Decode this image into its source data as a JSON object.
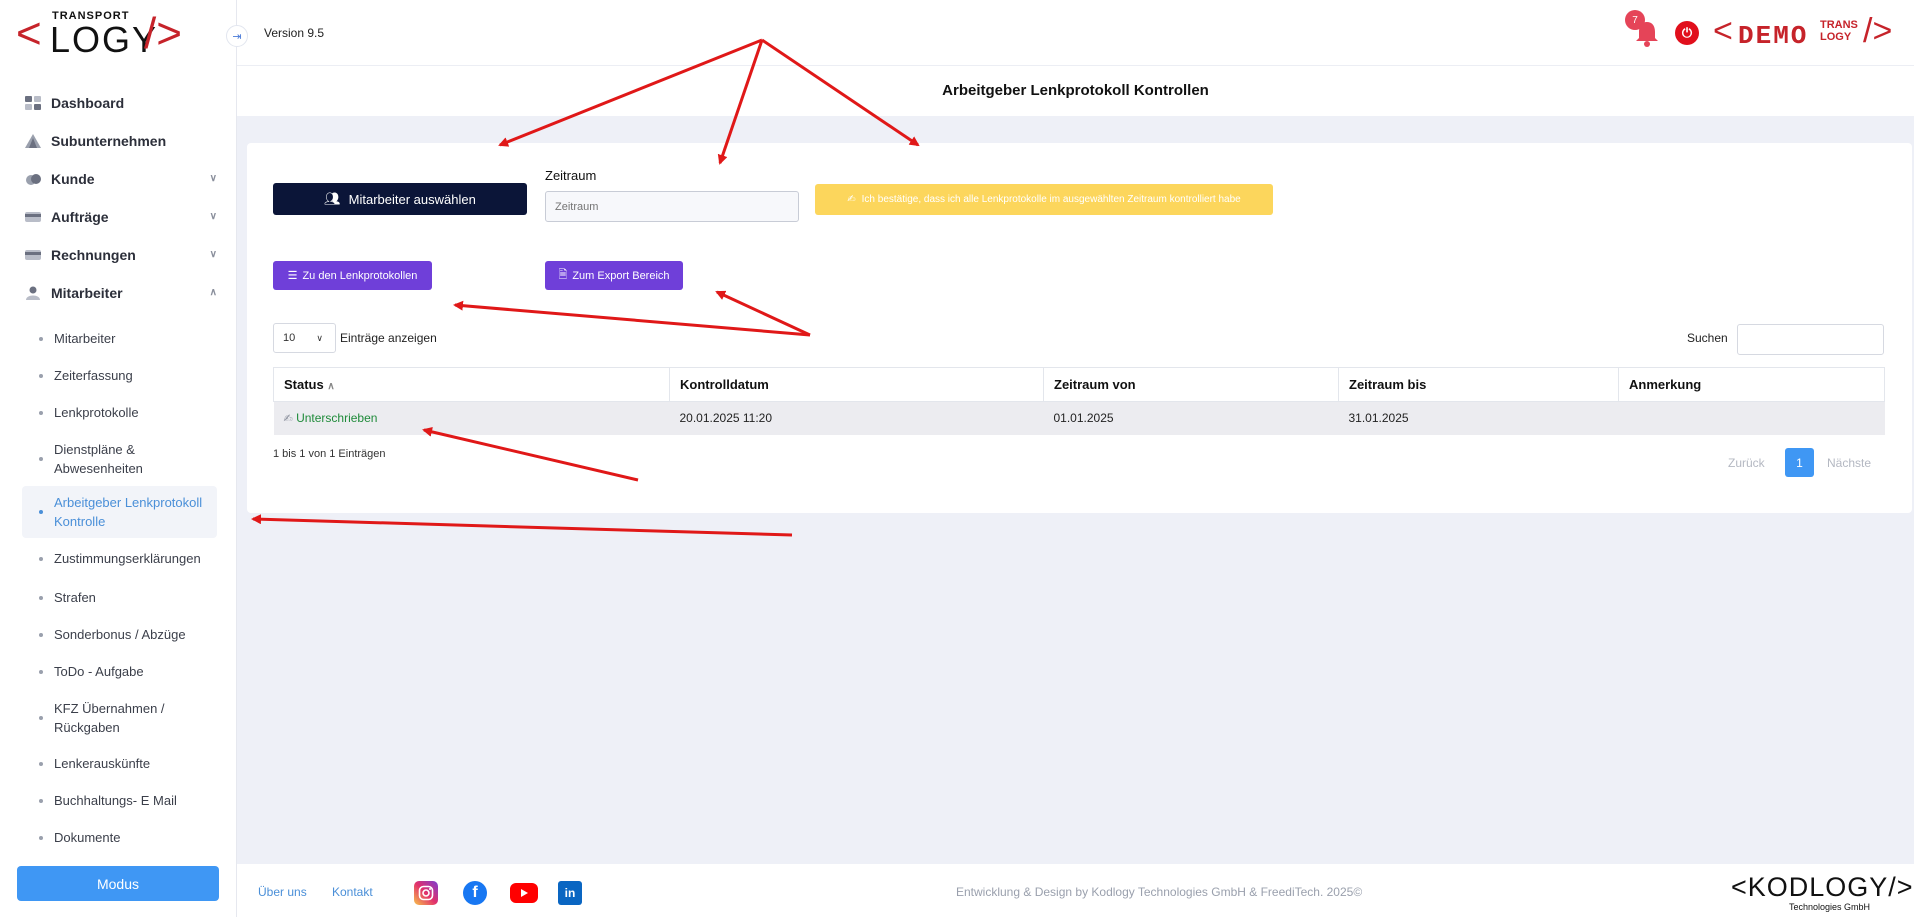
{
  "brand": {
    "logo_top": "TRANSPORT",
    "logo_main": "LOGY",
    "demo_main": "DEMO",
    "demo_sub1": "TRANS",
    "demo_sub2": "LOGY"
  },
  "header": {
    "version": "Version 9.5",
    "notifications_count": "7",
    "page_title": "Arbeitgeber Lenkprotokoll Kontrollen"
  },
  "sidebar": {
    "items": [
      {
        "label": "Dashboard",
        "icon": "dashboard-icon"
      },
      {
        "label": "Subunternehmen",
        "icon": "triangle-icon"
      },
      {
        "label": "Kunde",
        "icon": "cloud-icon"
      },
      {
        "label": "Aufträge",
        "icon": "card-icon"
      },
      {
        "label": "Rechnungen",
        "icon": "card-icon"
      },
      {
        "label": "Mitarbeiter",
        "icon": "user-icon"
      }
    ],
    "sub_items": [
      "Mitarbeiter",
      "Zeiterfassung",
      "Lenkprotokolle",
      "Dienstpläne & Abwesenheiten",
      "Arbeitgeber Lenkprotokoll Kontrolle",
      "Zustimmungserklärungen",
      "Strafen",
      "Sonderbonus / Abzüge",
      "ToDo - Aufgabe",
      "KFZ Übernahmen / Rückgaben",
      "Lenkerauskünfte",
      "Buchhaltungs- E Mail",
      "Dokumente"
    ],
    "modus_label": "Modus"
  },
  "form": {
    "select_employee": "Mitarbeiter auswählen",
    "period_label": "Zeitraum",
    "period_placeholder": "Zeitraum",
    "confirm_text": "Ich bestätige, dass ich alle Lenkprotokolle im ausgewählten Zeitraum kontrolliert habe",
    "to_logs": "Zu den Lenkprotokollen",
    "to_export": "Zum Export Bereich"
  },
  "table": {
    "page_size": "10",
    "entries_label": "Einträge anzeigen",
    "search_label": "Suchen",
    "columns": [
      "Status",
      "Kontrolldatum",
      "Zeitraum von",
      "Zeitraum bis",
      "Anmerkung"
    ],
    "rows": [
      {
        "status": "Unterschrieben",
        "date": "20.01.2025 11:20",
        "from": "01.01.2025",
        "to": "31.01.2025",
        "note": ""
      }
    ],
    "info": "1 bis 1 von 1 Einträgen",
    "prev": "Zurück",
    "page": "1",
    "next": "Nächste"
  },
  "footer": {
    "about": "Über uns",
    "contact": "Kontakt",
    "credit": "Entwicklung & Design by Kodlogy Technologies GmbH & FreediTech. 2025©",
    "kod_main": "<KODLOGY/>",
    "kod_sub": "Technologies  GmbH"
  },
  "colors": {
    "brand_red": "#c6232a",
    "primary_blue": "#3f97f4",
    "purple": "#6f3fd9",
    "navy": "#0b1538",
    "yellow": "#fcd65c",
    "success_green": "#1f8b3a",
    "arrow_red": "#e01818"
  }
}
